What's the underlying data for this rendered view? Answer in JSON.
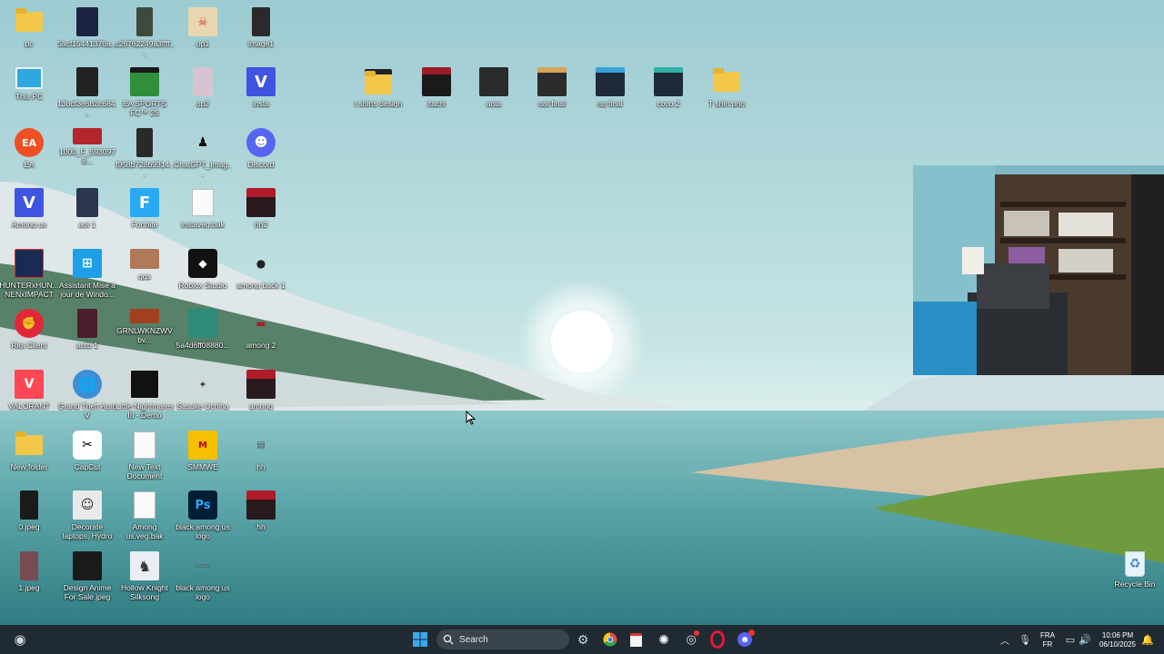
{
  "desktop": {
    "icons": [
      {
        "label": "pc",
        "kind": "folder"
      },
      {
        "label": "5acf15441376a...",
        "kind": "image"
      },
      {
        "label": "c26762249a3ffff...",
        "kind": "image"
      },
      {
        "label": "op1",
        "kind": "image"
      },
      {
        "label": "image1",
        "kind": "image"
      },
      {
        "label": "This PC",
        "kind": "monitor"
      },
      {
        "label": "13bdf3e6b2c684...",
        "kind": "image"
      },
      {
        "label": "EA SPORTS FC™ 25",
        "kind": "game"
      },
      {
        "label": "op2",
        "kind": "image"
      },
      {
        "label": "insta",
        "kind": "app-v"
      },
      {
        "label": "EA",
        "kind": "ea"
      },
      {
        "label": "1000_F_5930978...",
        "kind": "image"
      },
      {
        "label": "f958b728b9314...",
        "kind": "image"
      },
      {
        "label": "ChatGPT_Imag...",
        "kind": "image"
      },
      {
        "label": "Discord",
        "kind": "discord"
      },
      {
        "label": "Among us",
        "kind": "app-v"
      },
      {
        "label": "aot 1",
        "kind": "image"
      },
      {
        "label": "Fortnite",
        "kind": "fortnite"
      },
      {
        "label": "instaveg.bak",
        "kind": "doc"
      },
      {
        "label": "hh2",
        "kind": "image"
      },
      {
        "label": "HUNTERxHUN... NENxIMPACT",
        "kind": "game"
      },
      {
        "label": "Assistant Mise à jour de Windo...",
        "kind": "windows"
      },
      {
        "label": "ggs",
        "kind": "image"
      },
      {
        "label": "Roblox Studio",
        "kind": "roblox"
      },
      {
        "label": "among back 1",
        "kind": "image"
      },
      {
        "label": "Riot Client",
        "kind": "riot"
      },
      {
        "label": "aoto 1",
        "kind": "image"
      },
      {
        "label": "GRNLWKNZWVbv...",
        "kind": "image"
      },
      {
        "label": "5a4d6ff08880...",
        "kind": "image"
      },
      {
        "label": "among 2",
        "kind": "image"
      },
      {
        "label": "VALORANT",
        "kind": "valorant"
      },
      {
        "label": "Grand Theft Auto V",
        "kind": "gta"
      },
      {
        "label": "Little Nightmares III - Demo",
        "kind": "game"
      },
      {
        "label": "Sasuke Uchiha",
        "kind": "image"
      },
      {
        "label": "among",
        "kind": "image"
      },
      {
        "label": "New folder",
        "kind": "folder"
      },
      {
        "label": "CapCut",
        "kind": "capcut"
      },
      {
        "label": "New Text Document",
        "kind": "doc"
      },
      {
        "label": "SMMWE",
        "kind": "game"
      },
      {
        "label": "hh",
        "kind": "image"
      },
      {
        "label": "0.jpeg",
        "kind": "image"
      },
      {
        "label": "Decorate laptops, Hydro Flasks, c...",
        "kind": "image"
      },
      {
        "label": "Among us.veg.bak",
        "kind": "doc"
      },
      {
        "label": "black among us logo",
        "kind": "photoshop"
      },
      {
        "label": "hh",
        "kind": "image"
      },
      {
        "label": "1.jpeg",
        "kind": "image"
      },
      {
        "label": "Design Anime For Sale.jpeg",
        "kind": "image"
      },
      {
        "label": "Hollow Knight Silksong",
        "kind": "game"
      },
      {
        "label": "black among us logo",
        "kind": "image"
      },
      {
        "label": "t shirts design",
        "kind": "folder-dark"
      },
      {
        "label": "itachi",
        "kind": "image"
      },
      {
        "label": "aota",
        "kind": "image"
      },
      {
        "label": "oat final",
        "kind": "image"
      },
      {
        "label": "op final",
        "kind": "image"
      },
      {
        "label": "coco 2",
        "kind": "image"
      },
      {
        "label": "T shirt png",
        "kind": "folder"
      },
      {
        "label": "Recycle Bin",
        "kind": "recycle"
      }
    ]
  },
  "taskbar": {
    "search_label": "Search",
    "tray": {
      "lang_top": "FRA",
      "lang_bottom": "FR",
      "time": "10:06 PM",
      "date": "06/10/2025"
    }
  },
  "colors": {
    "sky": "#a9d2d6",
    "water": "#5ea5aa",
    "taskbar": "#1f2a33",
    "folder": "#f3c84a"
  }
}
